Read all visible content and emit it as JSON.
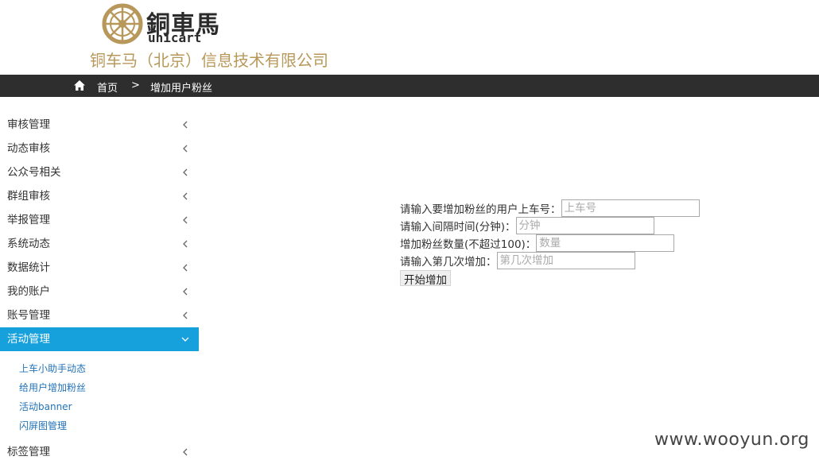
{
  "header": {
    "logo_text_cn": "銅車馬",
    "logo_text_en": "unicart",
    "company_name": "铜车马（北京）信息技术有限公司"
  },
  "breadcrumb": {
    "home": "首页",
    "separator": ">",
    "current": "增加用户粉丝"
  },
  "sidebar": {
    "items": [
      {
        "label": "审核管理"
      },
      {
        "label": "动态审核"
      },
      {
        "label": "公众号相关"
      },
      {
        "label": "群组审核"
      },
      {
        "label": "举报管理"
      },
      {
        "label": "系统动态"
      },
      {
        "label": "数据统计"
      },
      {
        "label": "我的账户"
      },
      {
        "label": "账号管理"
      },
      {
        "label": "活动管理"
      }
    ],
    "active_submenu": [
      {
        "label": "上车小助手动态"
      },
      {
        "label": "给用户增加粉丝"
      },
      {
        "label": "活动banner"
      },
      {
        "label": "闪屏图管理"
      }
    ],
    "after_items": [
      {
        "label": "标签管理"
      }
    ]
  },
  "form": {
    "user_label": "请输入要增加粉丝的用户上车号：",
    "user_placeholder": "上车号",
    "user_value": "",
    "interval_label": "请输入间隔时间(分钟)：",
    "interval_placeholder": "分钟",
    "interval_value": "",
    "count_label": "增加粉丝数量(不超过100)：",
    "count_placeholder": "数量",
    "count_value": "",
    "round_label": "请输入第几次增加：",
    "round_placeholder": "第几次增加",
    "round_value": "",
    "submit_label": "开始增加"
  },
  "watermark": "www.wooyun.org",
  "colors": {
    "topbar_bg": "#2e2e2e",
    "active_menu_bg": "#16a1dd",
    "submenu_link": "#2273b8",
    "company_gold": "#b8985a"
  }
}
